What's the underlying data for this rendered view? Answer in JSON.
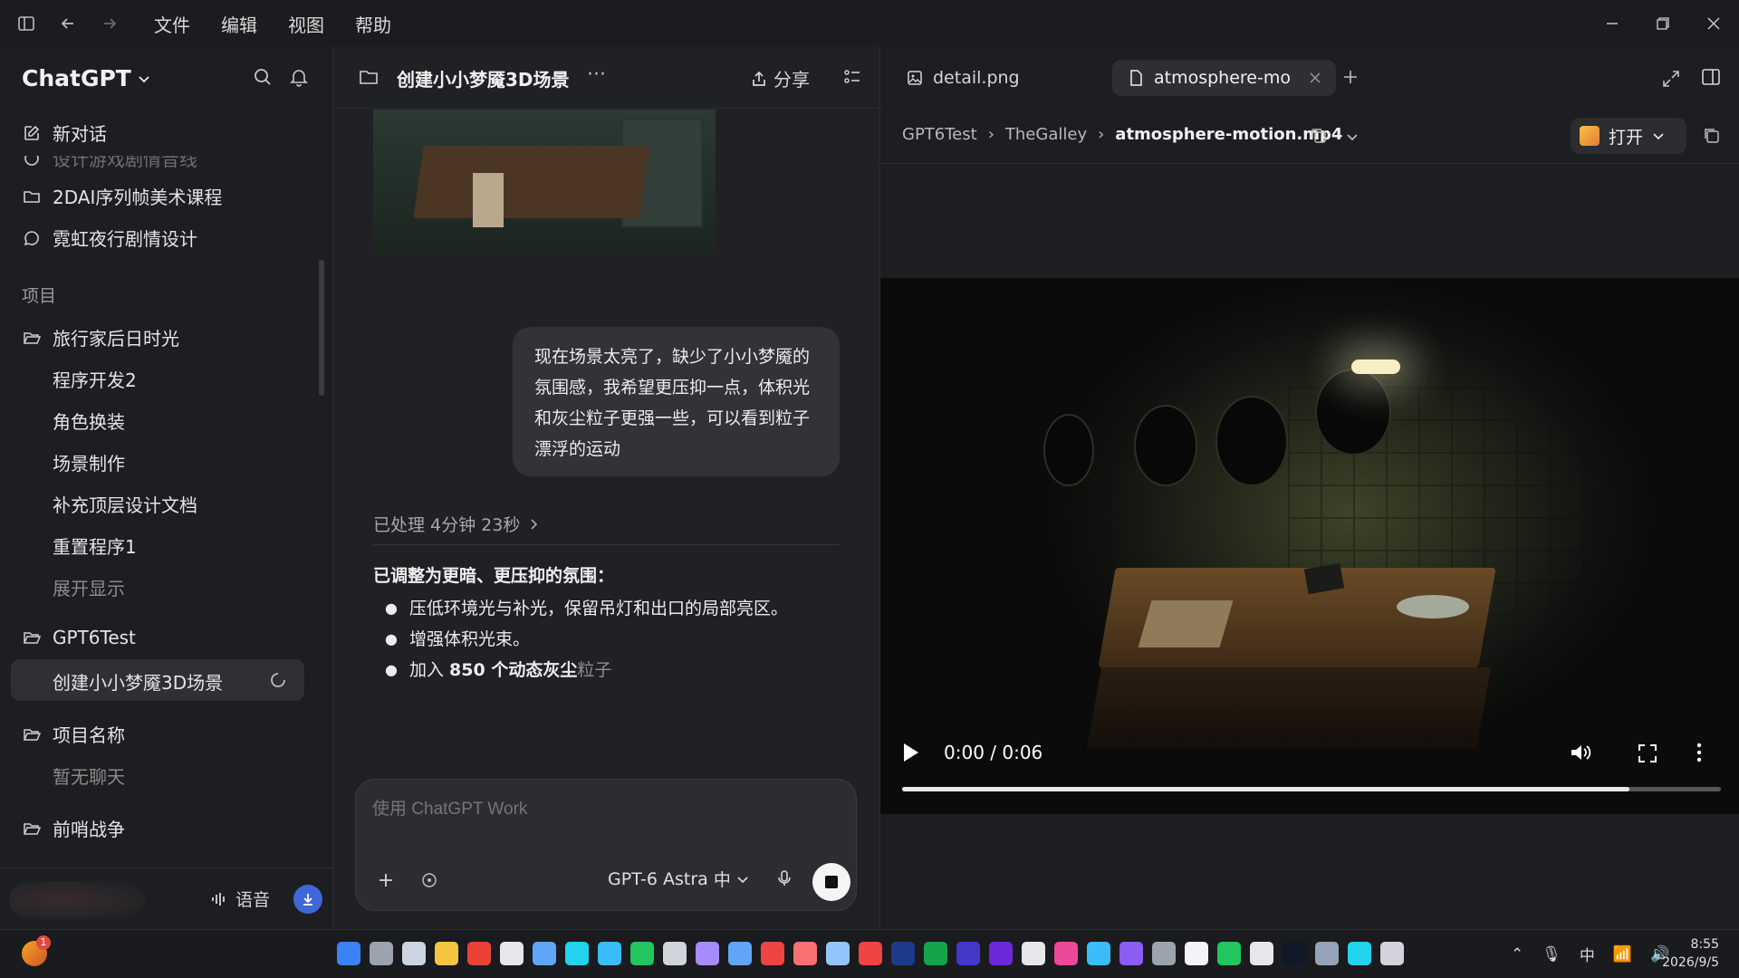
{
  "menu": [
    "文件",
    "编辑",
    "视图",
    "帮助"
  ],
  "sidebar": {
    "brand": "ChatGPT",
    "new_chat": "新对话",
    "cut_item": "设计游戏剧情音线",
    "items_top": [
      "2DAI序列帧美术课程",
      "霓虹夜行剧情设计"
    ],
    "section_projects": "项目",
    "project1": {
      "name": "旅行家后日时光",
      "children": [
        "程序开发2",
        "角色换装",
        "场景制作",
        "补充顶层设计文档",
        "重置程序1"
      ],
      "expand": "展开显示"
    },
    "project2": {
      "name": "GPT6Test",
      "active_child": "创建小小梦魇3D场景"
    },
    "project3": {
      "name": "项目名称",
      "empty": "暂无聊天"
    },
    "project4": {
      "name": "前哨战争"
    },
    "voice_label": "语音"
  },
  "chat": {
    "title": "创建小小梦魇3D场景",
    "more": "···",
    "share": "分享",
    "user_message": "现在场景太亮了，缺少了小小梦魇的氛围感，我希望更压抑一点，体积光和灰尘粒子更强一些，可以看到粒子漂浮的运动",
    "processed": "已处理 4分钟 23秒",
    "answer_heading": "已调整为更暗、更压抑的氛围：",
    "bullets": [
      "压低环境光与补光，保留吊灯和出口的局部亮区。",
      "增强体积光束。"
    ],
    "bullet3_prefix": "加入 ",
    "bullet3_bold": "850 个动态灰尘",
    "bullet3_fade": "粒子",
    "composer_placeholder": "使用 ChatGPT Work",
    "model": "GPT-6 Astra",
    "model_level": "中"
  },
  "preview": {
    "tab1": "detail.png",
    "tab2": "atmosphere-mo",
    "breadcrumbs": [
      "GPT6Test",
      "TheGalley"
    ],
    "current_file": "atmosphere-motion.mp4",
    "open_label": "打开",
    "video_time": "0:00 / 0:06",
    "progress_fraction": 0.888
  },
  "taskbar": {
    "badge": "1",
    "time": "8:55",
    "date": "2026/9/5",
    "ime": "中"
  }
}
